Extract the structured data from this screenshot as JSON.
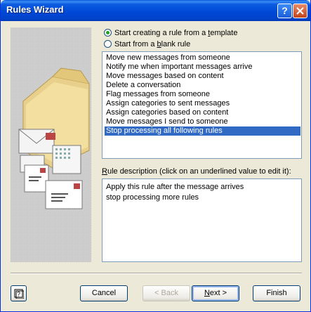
{
  "window": {
    "title": "Rules Wizard"
  },
  "radios": [
    {
      "label_pre": "Start creating a rule from a ",
      "label_ul": "t",
      "label_post": "emplate",
      "checked": true
    },
    {
      "label_pre": "Start from a ",
      "label_ul": "b",
      "label_post": "lank rule",
      "checked": false
    }
  ],
  "templates": [
    "Move new messages from someone",
    "Notify me when important messages arrive",
    "Move messages based on content",
    "Delete a conversation",
    "Flag messages from someone",
    "Assign categories to sent messages",
    "Assign categories based on content",
    "Move messages I send to someone",
    "Stop processing all following rules"
  ],
  "selected_template_index": 8,
  "description": {
    "label_pre": "",
    "label_ul": "R",
    "label_post": "ule description (click on an underlined value to edit it):",
    "lines": [
      "Apply this rule after the message arrives",
      "stop processing more rules"
    ]
  },
  "buttons": {
    "cancel": "Cancel",
    "back": "< Back",
    "next_ul": "N",
    "next_rest": "ext >",
    "finish": "Finish"
  },
  "colors": {
    "selection": "#316ac5",
    "titlebar": "#0047d6",
    "face": "#ece9d8"
  },
  "icons": {
    "help": "help-icon",
    "close": "close-icon",
    "illustration": "folder-envelopes-illustration"
  }
}
